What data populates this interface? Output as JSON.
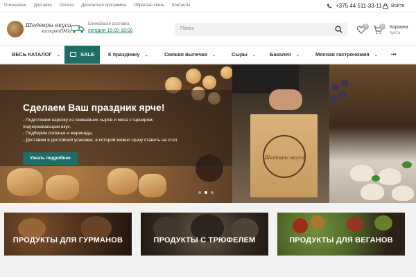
{
  "topbar": {
    "links": [
      "О магазине",
      "Доставка",
      "Оплата",
      "Дисконтная программа",
      "Обратная связь",
      "Контакты"
    ],
    "phone": "+375 44 511-33-11",
    "login": "Войти"
  },
  "header": {
    "logo_title": "Шедевры вкуса",
    "logo_sub": "гастроnOMia",
    "delivery_label": "Ближайшая доставка",
    "delivery_time": "сегодня 16:00-18:00",
    "search_placeholder": "Поиск",
    "favorites_count": "0",
    "cart_count": "0",
    "cart_label": "Корзина",
    "cart_status": "пуста"
  },
  "nav": {
    "catalog": "ВЕСЬ КАТАЛОГ",
    "sale": "SALE",
    "items": [
      "К празднику",
      "Свежая выпечка",
      "Сыры",
      "Бакалея",
      "Мясная гастрономия"
    ],
    "more": "•••"
  },
  "hero": {
    "title": "Сделаем Ваш праздник ярче!",
    "lines": [
      "- Подготовим нарезку из свежайших сыров и мяса с гарниром,",
      "подчеркивающим вкус.",
      "- Подберем соленья и маринады.",
      "- Доставим в достойной упаковке, в которой можно сразу ставить на стол."
    ],
    "button": "Узнать подробнее",
    "bag_stamp": "Шедевры вкуса",
    "slides": 3,
    "active_slide": 2
  },
  "promos": [
    {
      "label": "ПРОДУКТЫ ДЛЯ ГУРМАНОВ"
    },
    {
      "label": "ПРОДУКТЫ С ТРЮФЕЛЕМ"
    },
    {
      "label": "ПРОДУКТЫ ДЛЯ ВЕГАНОВ"
    }
  ],
  "colors": {
    "accent": "#1e6e67",
    "badge": "#b8b8b8"
  }
}
